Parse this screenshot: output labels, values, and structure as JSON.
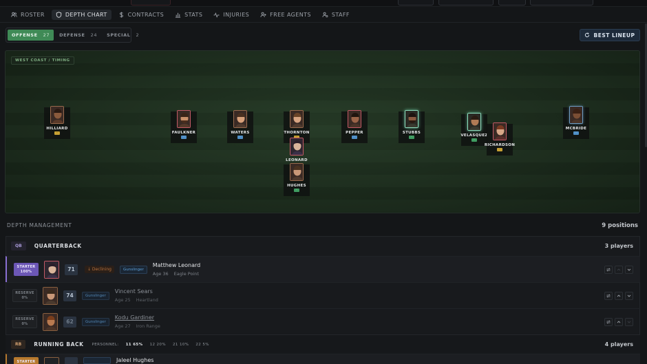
{
  "nav": {
    "tabs": [
      {
        "label": "ROSTER",
        "icon": "users-icon"
      },
      {
        "label": "DEPTH CHART",
        "icon": "shield-icon",
        "active": true
      },
      {
        "label": "CONTRACTS",
        "icon": "dollar-icon"
      },
      {
        "label": "STATS",
        "icon": "bar-chart-icon"
      },
      {
        "label": "INJURIES",
        "icon": "pulse-icon"
      },
      {
        "label": "FREE AGENTS",
        "icon": "user-plus-icon"
      },
      {
        "label": "STAFF",
        "icon": "user-gear-icon"
      }
    ]
  },
  "filters": [
    {
      "label": "OFFENSE",
      "count": "27",
      "active": true
    },
    {
      "label": "DEFENSE",
      "count": "24"
    },
    {
      "label": "SPECIAL",
      "count": "2"
    }
  ],
  "best_lineup_label": "BEST LINEUP",
  "field": {
    "scheme": "WEST COAST / TIMING",
    "players": [
      {
        "name": "HILLIARD",
        "color": "yellow"
      },
      {
        "name": "FAULKNER",
        "color": "blue"
      },
      {
        "name": "WATERS",
        "color": "blue"
      },
      {
        "name": "THORNTON",
        "color": "yellow"
      },
      {
        "name": "LEONARD",
        "color": "blue"
      },
      {
        "name": "HUGHES",
        "color": "green"
      },
      {
        "name": "PEPPER",
        "color": "blue"
      },
      {
        "name": "STUBBS",
        "color": "green"
      },
      {
        "name": "VELASQUEZ",
        "color": "green"
      },
      {
        "name": "RICHARDSON",
        "color": "yellow"
      },
      {
        "name": "MCBRIDE",
        "color": "blue"
      }
    ]
  },
  "depth": {
    "title": "DEPTH MANAGEMENT",
    "count_label": "9 positions"
  },
  "qb": {
    "badge": "QB",
    "title": "QUARTERBACK",
    "count_label": "3 players",
    "rows": [
      {
        "role": "STARTER",
        "pct": "100%",
        "ovr": "71",
        "trend": "↓ Declining",
        "archetype": "Gunslinger",
        "name": "Matthew Leonard",
        "age": "Age 36",
        "origin": "Eagle Point"
      },
      {
        "role": "RESERVE",
        "pct": "0%",
        "ovr": "74",
        "archetype": "Gunslinger",
        "name": "Vincent Sears",
        "age": "Age 25",
        "origin": "Heartland"
      },
      {
        "role": "RESERVE",
        "pct": "0%",
        "ovr": "62",
        "archetype": "Gunslinger",
        "name": "Kodu Gardiner",
        "age": "Age 27",
        "origin": "Iron Range"
      }
    ]
  },
  "rb": {
    "badge": "RB",
    "title": "RUNNING BACK",
    "personnel_label": "PERSONNEL:",
    "personnel": [
      {
        "code": "11",
        "pct": "65%"
      },
      {
        "code": "12",
        "pct": "20%"
      },
      {
        "code": "21",
        "pct": "10%"
      },
      {
        "code": "22",
        "pct": "5%"
      }
    ],
    "count_label": "4 players",
    "first": {
      "role": "STARTER",
      "name": "Jaleel Hughes"
    }
  },
  "colors": {
    "accent_green": "#3f8a56",
    "starter_purple": "#6c57b6",
    "declining": "#b8713d",
    "archetype_blue": "#5fa0d8"
  }
}
